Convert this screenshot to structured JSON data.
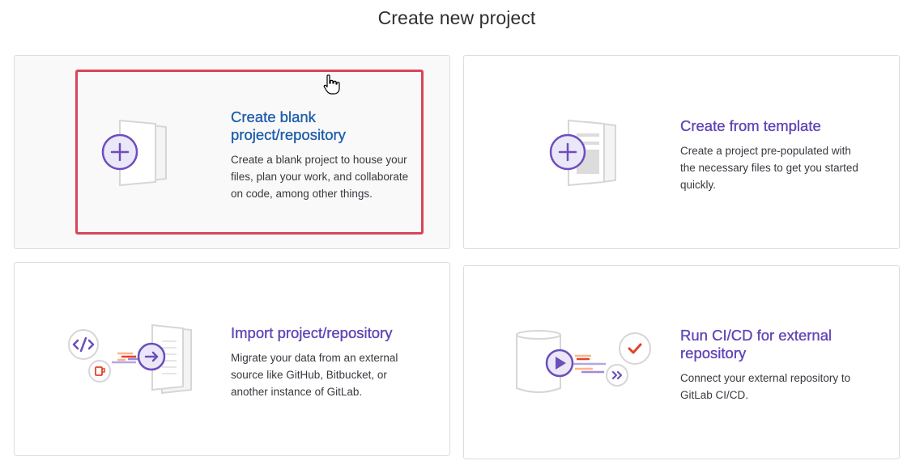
{
  "page": {
    "title": "Create new project"
  },
  "cards": {
    "blank": {
      "title_line1": "Create blank",
      "title_line2": "project/repository",
      "description_lines": [
        "Create a blank project to house your",
        "files, plan your work, and collaborate",
        "on code, among other things."
      ],
      "icon": "blank-project-illustration"
    },
    "template": {
      "title": "Create from template",
      "description_lines": [
        "Create a project pre-populated with",
        "the necessary files to get you started",
        "quickly."
      ],
      "icon": "template-project-illustration"
    },
    "import": {
      "title": "Import project/repository",
      "description_lines": [
        "Migrate your data from an external",
        "source like GitHub, Bitbucket, or",
        "another instance of GitLab."
      ],
      "icon": "import-project-illustration"
    },
    "cicd": {
      "title_line1": "Run CI/CD for external",
      "title_line2": "repository",
      "description_lines": [
        "Connect your external repository to",
        "GitLab CI/CD."
      ],
      "icon": "cicd-project-illustration"
    }
  },
  "colors": {
    "purple": "#6b4fbb",
    "purple_light": "#e9e4f7",
    "blue_link": "#1f5eab",
    "focus_red": "#d9455a",
    "orange": "#e24329"
  }
}
